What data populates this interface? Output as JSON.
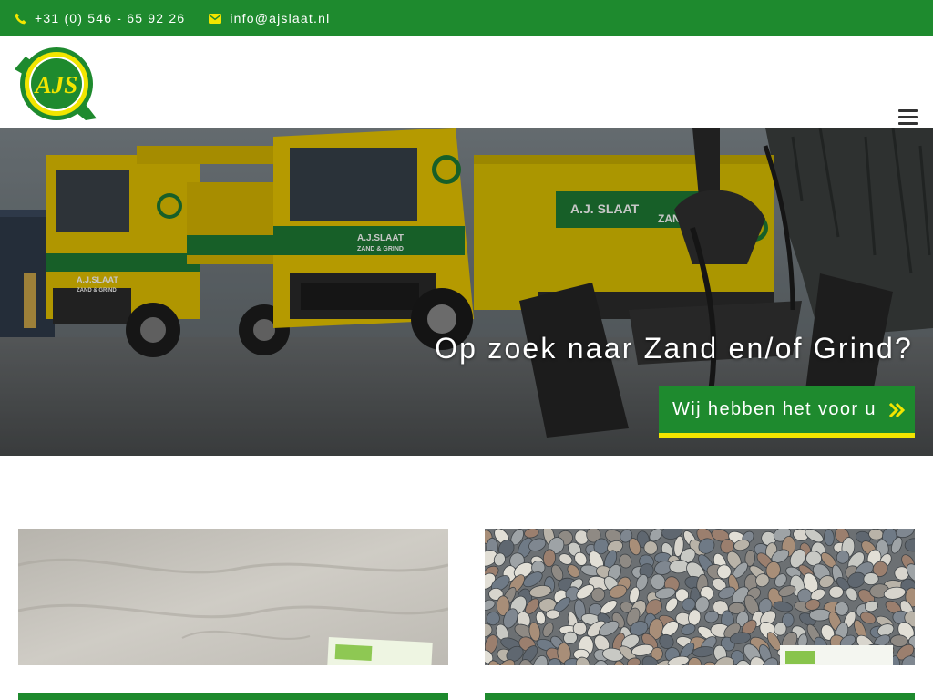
{
  "topbar": {
    "phone": "+31 (0) 546 - 65 92 26",
    "email": "info@ajslaat.nl",
    "phone_icon": "phone-icon",
    "email_icon": "envelope-icon"
  },
  "header": {
    "logo_text": "AJS",
    "menu_icon": "hamburger-icon"
  },
  "hero": {
    "title": "Op zoek naar Zand en/of Grind?",
    "button_label": "Wij hebben het voor u",
    "button_icon": "double-chevron-right-icon",
    "truck_text_1": "A.J.SLAAT",
    "truck_text_2": "ZAND & GRIND",
    "truck_text_3": "A.J. SLAAT",
    "truck_text_4": "ZAND"
  },
  "colors": {
    "brand_green": "#1e8a2e",
    "accent_yellow": "#f2e500",
    "white": "#ffffff"
  },
  "cards": [
    {
      "image": "sand-image"
    },
    {
      "image": "gravel-image"
    }
  ]
}
